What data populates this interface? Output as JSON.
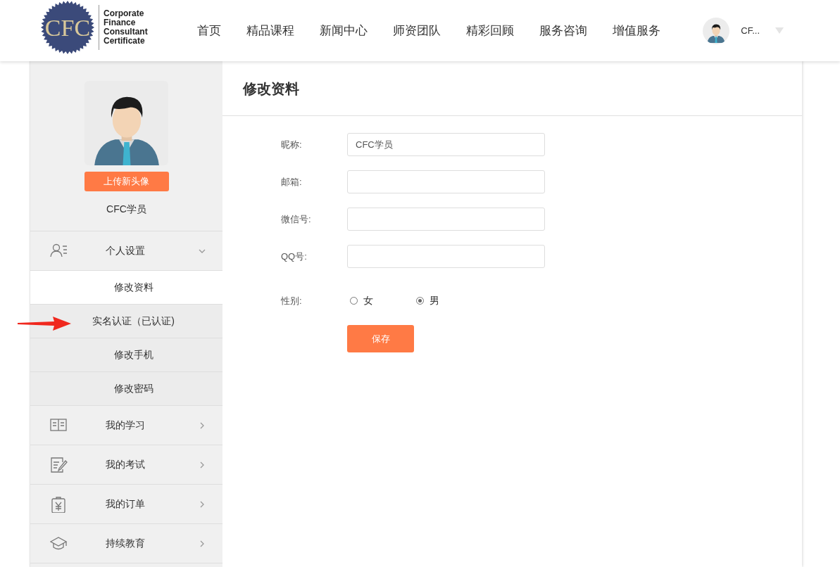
{
  "header": {
    "logo": {
      "mark": "CFC",
      "lines": [
        "Corporate",
        "Finance",
        "Consultant",
        "Certificate"
      ]
    },
    "nav": [
      "首页",
      "精品课程",
      "新闻中心",
      "师资团队",
      "精彩回顾",
      "服务咨询",
      "增值服务"
    ],
    "user": {
      "name": "CF..."
    }
  },
  "sidebar": {
    "upload_button": "上传新头像",
    "username": "CFC学员",
    "menu": [
      {
        "kind": "group",
        "label": "个人设置",
        "expanded": true,
        "children": [
          {
            "label": "修改资料",
            "selected": true
          },
          {
            "label": "实名认证（已认证)",
            "selected": false
          },
          {
            "label": "修改手机",
            "selected": false
          },
          {
            "label": "修改密码",
            "selected": false
          }
        ]
      },
      {
        "kind": "link",
        "label": "我的学习"
      },
      {
        "kind": "link",
        "label": "我的考试"
      },
      {
        "kind": "link",
        "label": "我的订单"
      },
      {
        "kind": "link",
        "label": "持续教育"
      }
    ]
  },
  "main": {
    "title": "修改资料",
    "fields": [
      {
        "label": "昵称:",
        "value": "CFC学员"
      },
      {
        "label": "邮箱:"
      },
      {
        "label": "微信号:"
      },
      {
        "label": "QQ号:"
      }
    ],
    "gender": {
      "label": "性别:",
      "options": [
        {
          "label": "女",
          "selected": false
        },
        {
          "label": "男",
          "selected": true
        }
      ]
    },
    "save_button": "保存"
  }
}
